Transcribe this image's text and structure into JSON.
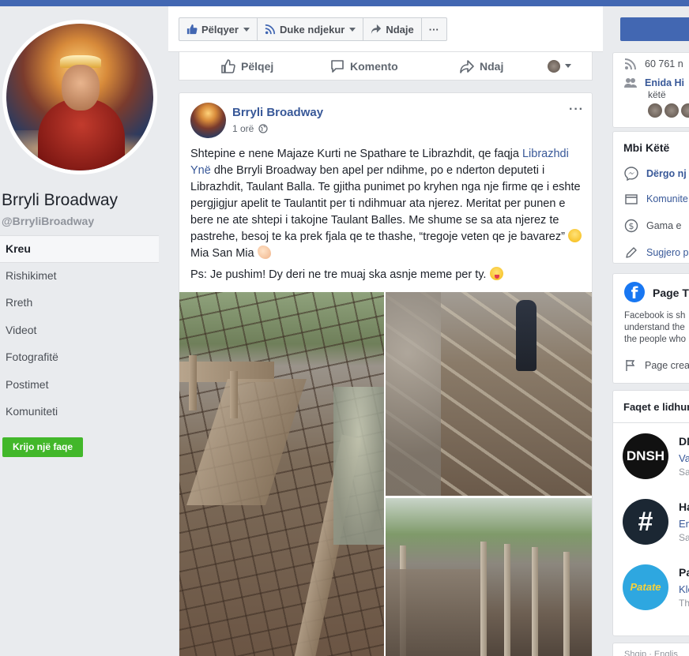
{
  "colors": {
    "brand_blue": "#4267b2",
    "link": "#385898",
    "create_green": "#42b72a"
  },
  "sidebar": {
    "page_name": "Brryli Broadway",
    "page_handle": "@BrryliBroadway",
    "nav": [
      {
        "label": "Kreu",
        "active": true
      },
      {
        "label": "Rishikimet"
      },
      {
        "label": "Rreth"
      },
      {
        "label": "Videot"
      },
      {
        "label": "Fotografitë"
      },
      {
        "label": "Postimet"
      },
      {
        "label": "Komuniteti"
      }
    ],
    "create_page_label": "Krijo një faqe"
  },
  "actionbar": {
    "like_label": "Pëlqyer",
    "follow_label": "Duke ndjekur",
    "share_label": "Ndaje",
    "more_label": "···"
  },
  "reactbar": {
    "like_label": "Pëlqej",
    "comment_label": "Komento",
    "share_label": "Ndaj"
  },
  "post": {
    "author": "Brryli Broadway",
    "time": "1 orë",
    "menu": "···",
    "text": {
      "p1_a": "Shtepine e nene Majaze Kurti ne Spathare te Librazhdit, qe faqja ",
      "p1_link": "Librazhdi Ynë",
      "p1_b": " dhe Brryli Broadway ben apel per ndihme, po e nderton deputeti i Librazhdit, Taulant Balla. Te gjitha punimet po kryhen nga nje firme qe i eshte pergjigjur apelit te Taulantit per ti ndihmuar ata njerez. Meritat per punen e bere ne ate shtepi i takojne Taulant Balles. Me shume se sa ata njerez te pastrehe, besoj te ka prek fjala qe te thashe, “tregoje veten qe je bavarez” ",
      "p1_c": " Mia San Mia ",
      "p2": "Ps: Je pushim! Dy deri ne tre muaj ska asnje meme per ty. "
    },
    "photos": [
      {
        "name": "photo-rebar-formwork"
      },
      {
        "name": "photo-worker-rebar"
      },
      {
        "name": "photo-walls-formwork"
      }
    ]
  },
  "right": {
    "likes_count": "60 761 n",
    "friend_like_name": "Enida Hi",
    "friend_like_suffix": "këtë",
    "about_title": "Mbi Këtë",
    "about_rows": [
      {
        "label": "Dërgo nj",
        "icon": "messenger-icon",
        "link": true
      },
      {
        "label": "Komunite",
        "icon": "community-icon",
        "link": true
      },
      {
        "label": "Gama e",
        "icon": "dollar-icon",
        "link": false
      },
      {
        "label": "Sugjero p",
        "icon": "pencil-icon",
        "link": true
      }
    ],
    "transparency_title": "Page T",
    "transparency_desc": [
      "Facebook is sh",
      "understand the",
      "the people who"
    ],
    "page_created": "Page crea",
    "related_title": "Faqet e lidhur",
    "related_pages": [
      {
        "initials": "DNSH",
        "name": "DN",
        "sub": "Va",
        "sub2": "Sa"
      },
      {
        "initials": "#",
        "name": "Ha",
        "sub": "En",
        "sub2": "Sa"
      },
      {
        "initials": "Patate",
        "name": "Pa",
        "sub": "Kle",
        "sub2": "Th"
      }
    ],
    "footer_text": "Shqip · Englis"
  }
}
